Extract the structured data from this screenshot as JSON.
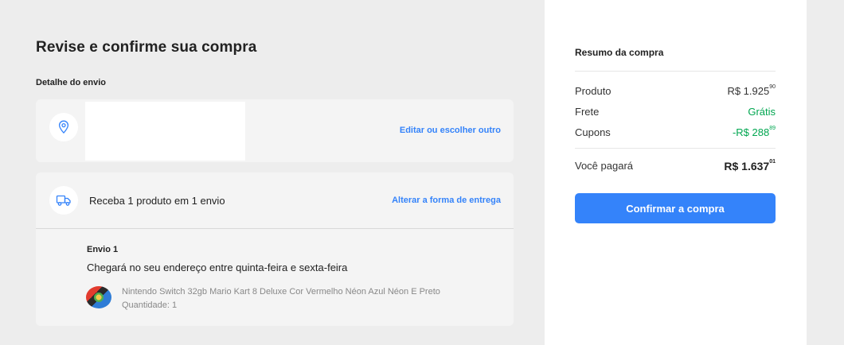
{
  "page": {
    "title": "Revise e confirme sua compra",
    "shipping_detail_label": "Detalhe do envio"
  },
  "address": {
    "icon": "location-pin-icon",
    "edit_link": "Editar ou escolher outro"
  },
  "delivery": {
    "icon": "truck-icon",
    "summary": "Receba 1 produto em 1 envio",
    "change_link": "Alterar a forma de entrega",
    "shipment": {
      "label": "Envio 1",
      "eta": "Chegará no seu endereço entre quinta-feira e sexta-feira",
      "product_name": "Nintendo Switch 32gb Mario Kart 8 Deluxe Cor Vermelho Néon Azul Néon E Preto",
      "quantity": "Quantidade: 1"
    }
  },
  "summary": {
    "title": "Resumo da compra",
    "product_label": "Produto",
    "product_value_main": "R$ 1.925",
    "product_value_cents": "90",
    "shipping_label": "Frete",
    "shipping_value": "Grátis",
    "coupons_label": "Cupons",
    "coupons_value_main": "-R$ 288",
    "coupons_value_cents": "89",
    "total_label": "Você pagará",
    "total_value_main": "R$ 1.637",
    "total_value_cents": "01",
    "confirm_button": "Confirmar a compra"
  },
  "colors": {
    "accent": "#3483fa",
    "success": "#00a650",
    "background": "#ededed"
  }
}
